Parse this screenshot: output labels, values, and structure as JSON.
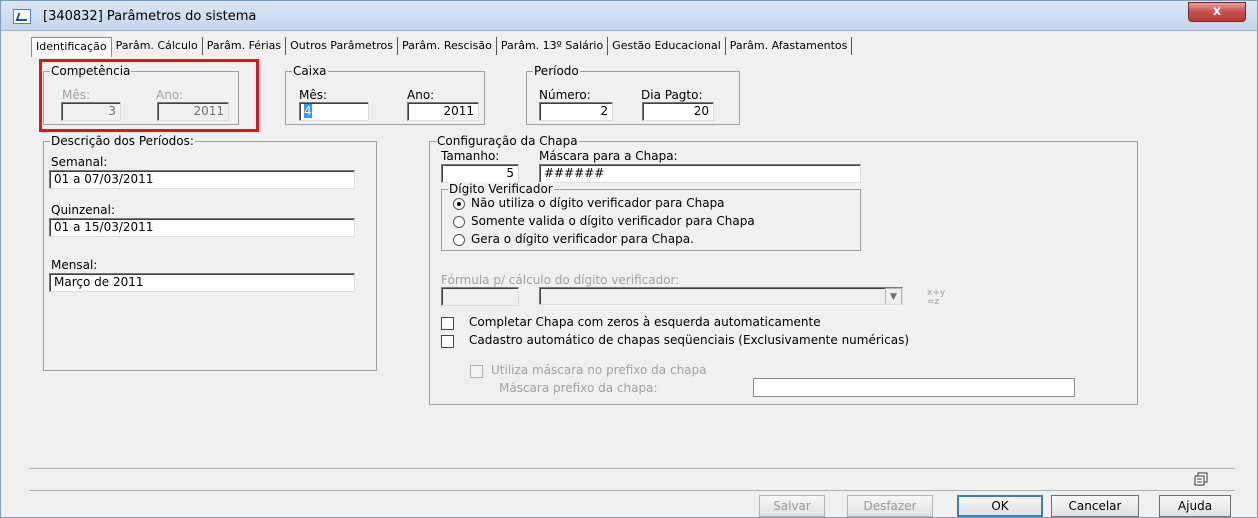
{
  "window": {
    "title": "[340832]  Parâmetros do sistema",
    "close": "x"
  },
  "tabs": [
    "Identificação",
    "Parâm. Cálculo",
    "Parâm. Férias",
    "Outros Parâmetros",
    "Parâm. Rescisão",
    "Parâm. 13º Salário",
    "Gestão Educacional",
    "Parâm. Afastamentos"
  ],
  "competencia": {
    "legend": "Competência",
    "mes_label": "Mês:",
    "mes_value": "3",
    "ano_label": "Ano:",
    "ano_value": "2011"
  },
  "caixa": {
    "legend": "Caixa",
    "mes_label": "Mês:",
    "mes_value": "4",
    "ano_label": "Ano:",
    "ano_value": "2011"
  },
  "periodo": {
    "legend": "Período",
    "numero_label": "Número:",
    "numero_value": "2",
    "dia_label": "Dia Pagto:",
    "dia_value": "20"
  },
  "descricao": {
    "legend": "Descrição dos Períodos:",
    "semanal_label": "Semanal:",
    "semanal_value": "01 a 07/03/2011",
    "quinzenal_label": "Quinzenal:",
    "quinzenal_value": "01 a 15/03/2011",
    "mensal_label": "Mensal:",
    "mensal_value": "Março de 2011"
  },
  "chapa": {
    "legend": "Configuração da Chapa",
    "tamanho_label": "Tamanho:",
    "tamanho_value": "5",
    "mascara_label": "Máscara para a Chapa:",
    "mascara_value": "######",
    "digito": {
      "legend": "Dígito Verificador",
      "options": [
        "Não utiliza o dígito verificador para Chapa",
        "Somente valida o dígito verificador para Chapa",
        "Gera o dígito verificador para Chapa."
      ],
      "selected": 0
    },
    "formula_label": "Fórmula p/ cálculo do dígito verificador:",
    "formula_icon_top": "x+y",
    "formula_icon_bottom": "=z",
    "completar_label": "Completar Chapa com zeros à esquerda automaticamente",
    "cadastro_label": "Cadastro automático de chapas seqüenciais (Exclusivamente numéricas)",
    "prefixo_check_label": "Utiliza máscara no prefixo da chapa",
    "prefixo_label": "Máscara prefixo da chapa:"
  },
  "buttons": {
    "salvar": "Salvar",
    "desfazer": "Desfazer",
    "ok": "OK",
    "cancelar": "Cancelar",
    "ajuda": "Ajuda"
  },
  "colors": {
    "highlight": "#e0141e",
    "selection": "#3399ff"
  }
}
